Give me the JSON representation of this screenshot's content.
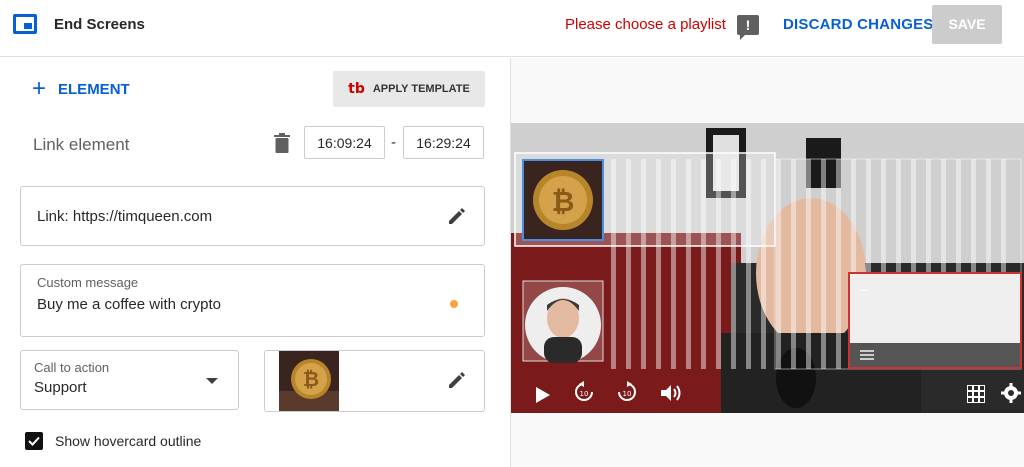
{
  "header": {
    "title": "End Screens",
    "warning": "Please choose a playlist",
    "discard_label": "DISCARD CHANGES",
    "save_label": "SAVE"
  },
  "toolbar": {
    "add_element_label": "ELEMENT",
    "apply_template_label": "APPLY TEMPLATE"
  },
  "element": {
    "title": "Link element",
    "start_time": "16:09:24",
    "end_time": "16:29:24",
    "separator": "-"
  },
  "link_field": {
    "value": "Link: https://timqueen.com"
  },
  "custom_message": {
    "label": "Custom message",
    "value": "Buy me a coffee with crypto"
  },
  "call_to_action": {
    "label": "Call to action",
    "value": "Support"
  },
  "hovercard": {
    "label": "Show hovercard outline",
    "checked": true
  },
  "video_overlay": {
    "playlist_placeholder": "..."
  },
  "colors": {
    "accent": "#065fd4",
    "warning": "#cc0000",
    "save_disabled": "#cccccc",
    "checkbox": "#111111"
  }
}
